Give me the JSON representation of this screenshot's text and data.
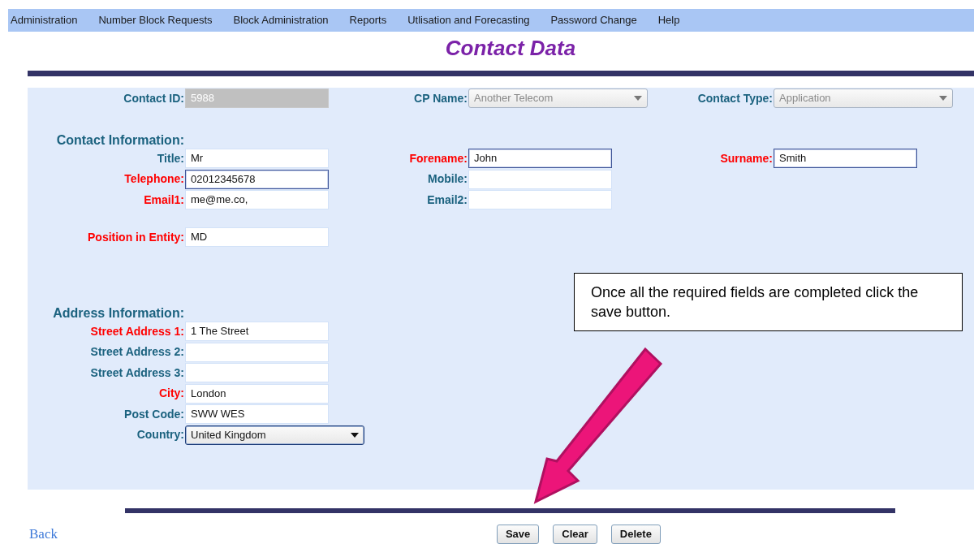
{
  "menu": [
    "Administration",
    "Number Block Requests",
    "Block Administration",
    "Reports",
    "Utlisation and Forecasting",
    "Password Change",
    "Help"
  ],
  "title": "Contact Data",
  "sections": [
    {
      "rows": [
        [
          {
            "kind": "readonly",
            "label": "Contact ID:",
            "value": "5988",
            "required": false
          },
          {
            "kind": "select",
            "label": "CP Name:",
            "value": "Another Telecom",
            "required": false,
            "focused": false,
            "disabled": true
          },
          {
            "kind": "select",
            "label": "Contact Type:",
            "value": "Application",
            "required": false,
            "focused": false,
            "disabled": true
          }
        ]
      ]
    },
    {
      "heading": "Contact Information:",
      "rows": [
        [
          {
            "kind": "text",
            "label": "Title:",
            "value": "Mr",
            "required": false,
            "focused": false
          },
          {
            "kind": "text",
            "label": "Forename:",
            "value": "John",
            "required": true,
            "focused": true
          },
          {
            "kind": "text",
            "label": "Surname:",
            "value": "Smith",
            "required": true,
            "focused": true
          }
        ],
        [
          {
            "kind": "text",
            "label": "Telephone:",
            "value": "02012345678",
            "required": true,
            "focused": true
          },
          {
            "kind": "text",
            "label": "Mobile:",
            "required": false,
            "focused": false
          }
        ],
        [
          {
            "kind": "text",
            "label": "Email1:",
            "value": "me@me.co,",
            "required": true,
            "focused": false
          },
          {
            "kind": "text",
            "label": "Email2:",
            "required": false,
            "focused": false
          }
        ]
      ]
    },
    {
      "rows": [
        [
          {
            "kind": "text",
            "label": "Position in Entity:",
            "value": "MD",
            "required": true,
            "focused": false
          }
        ]
      ]
    },
    {
      "heading": "Address Information:",
      "rows": [
        [
          {
            "kind": "text",
            "label": "Street Address 1:",
            "value": "1 The Street",
            "required": true,
            "focused": false
          }
        ],
        [
          {
            "kind": "text",
            "label": "Street Address 2:",
            "required": false,
            "focused": false
          }
        ],
        [
          {
            "kind": "text",
            "label": "Street Address 3:",
            "required": false,
            "focused": false
          }
        ],
        [
          {
            "kind": "text",
            "label": "City:",
            "value": "London",
            "required": true,
            "focused": false
          }
        ],
        [
          {
            "kind": "text",
            "label": "Post Code:",
            "value": "SWW WES",
            "required": false,
            "focused": false
          }
        ],
        [
          {
            "kind": "select",
            "label": "Country:",
            "value": "United Kingdom",
            "required": false,
            "focused": true,
            "disabled": false
          }
        ]
      ]
    }
  ],
  "callout": "Once all the required fields are completed click the save button.",
  "back_link": "Back",
  "buttons": [
    "Save",
    "Clear",
    "Delete"
  ]
}
